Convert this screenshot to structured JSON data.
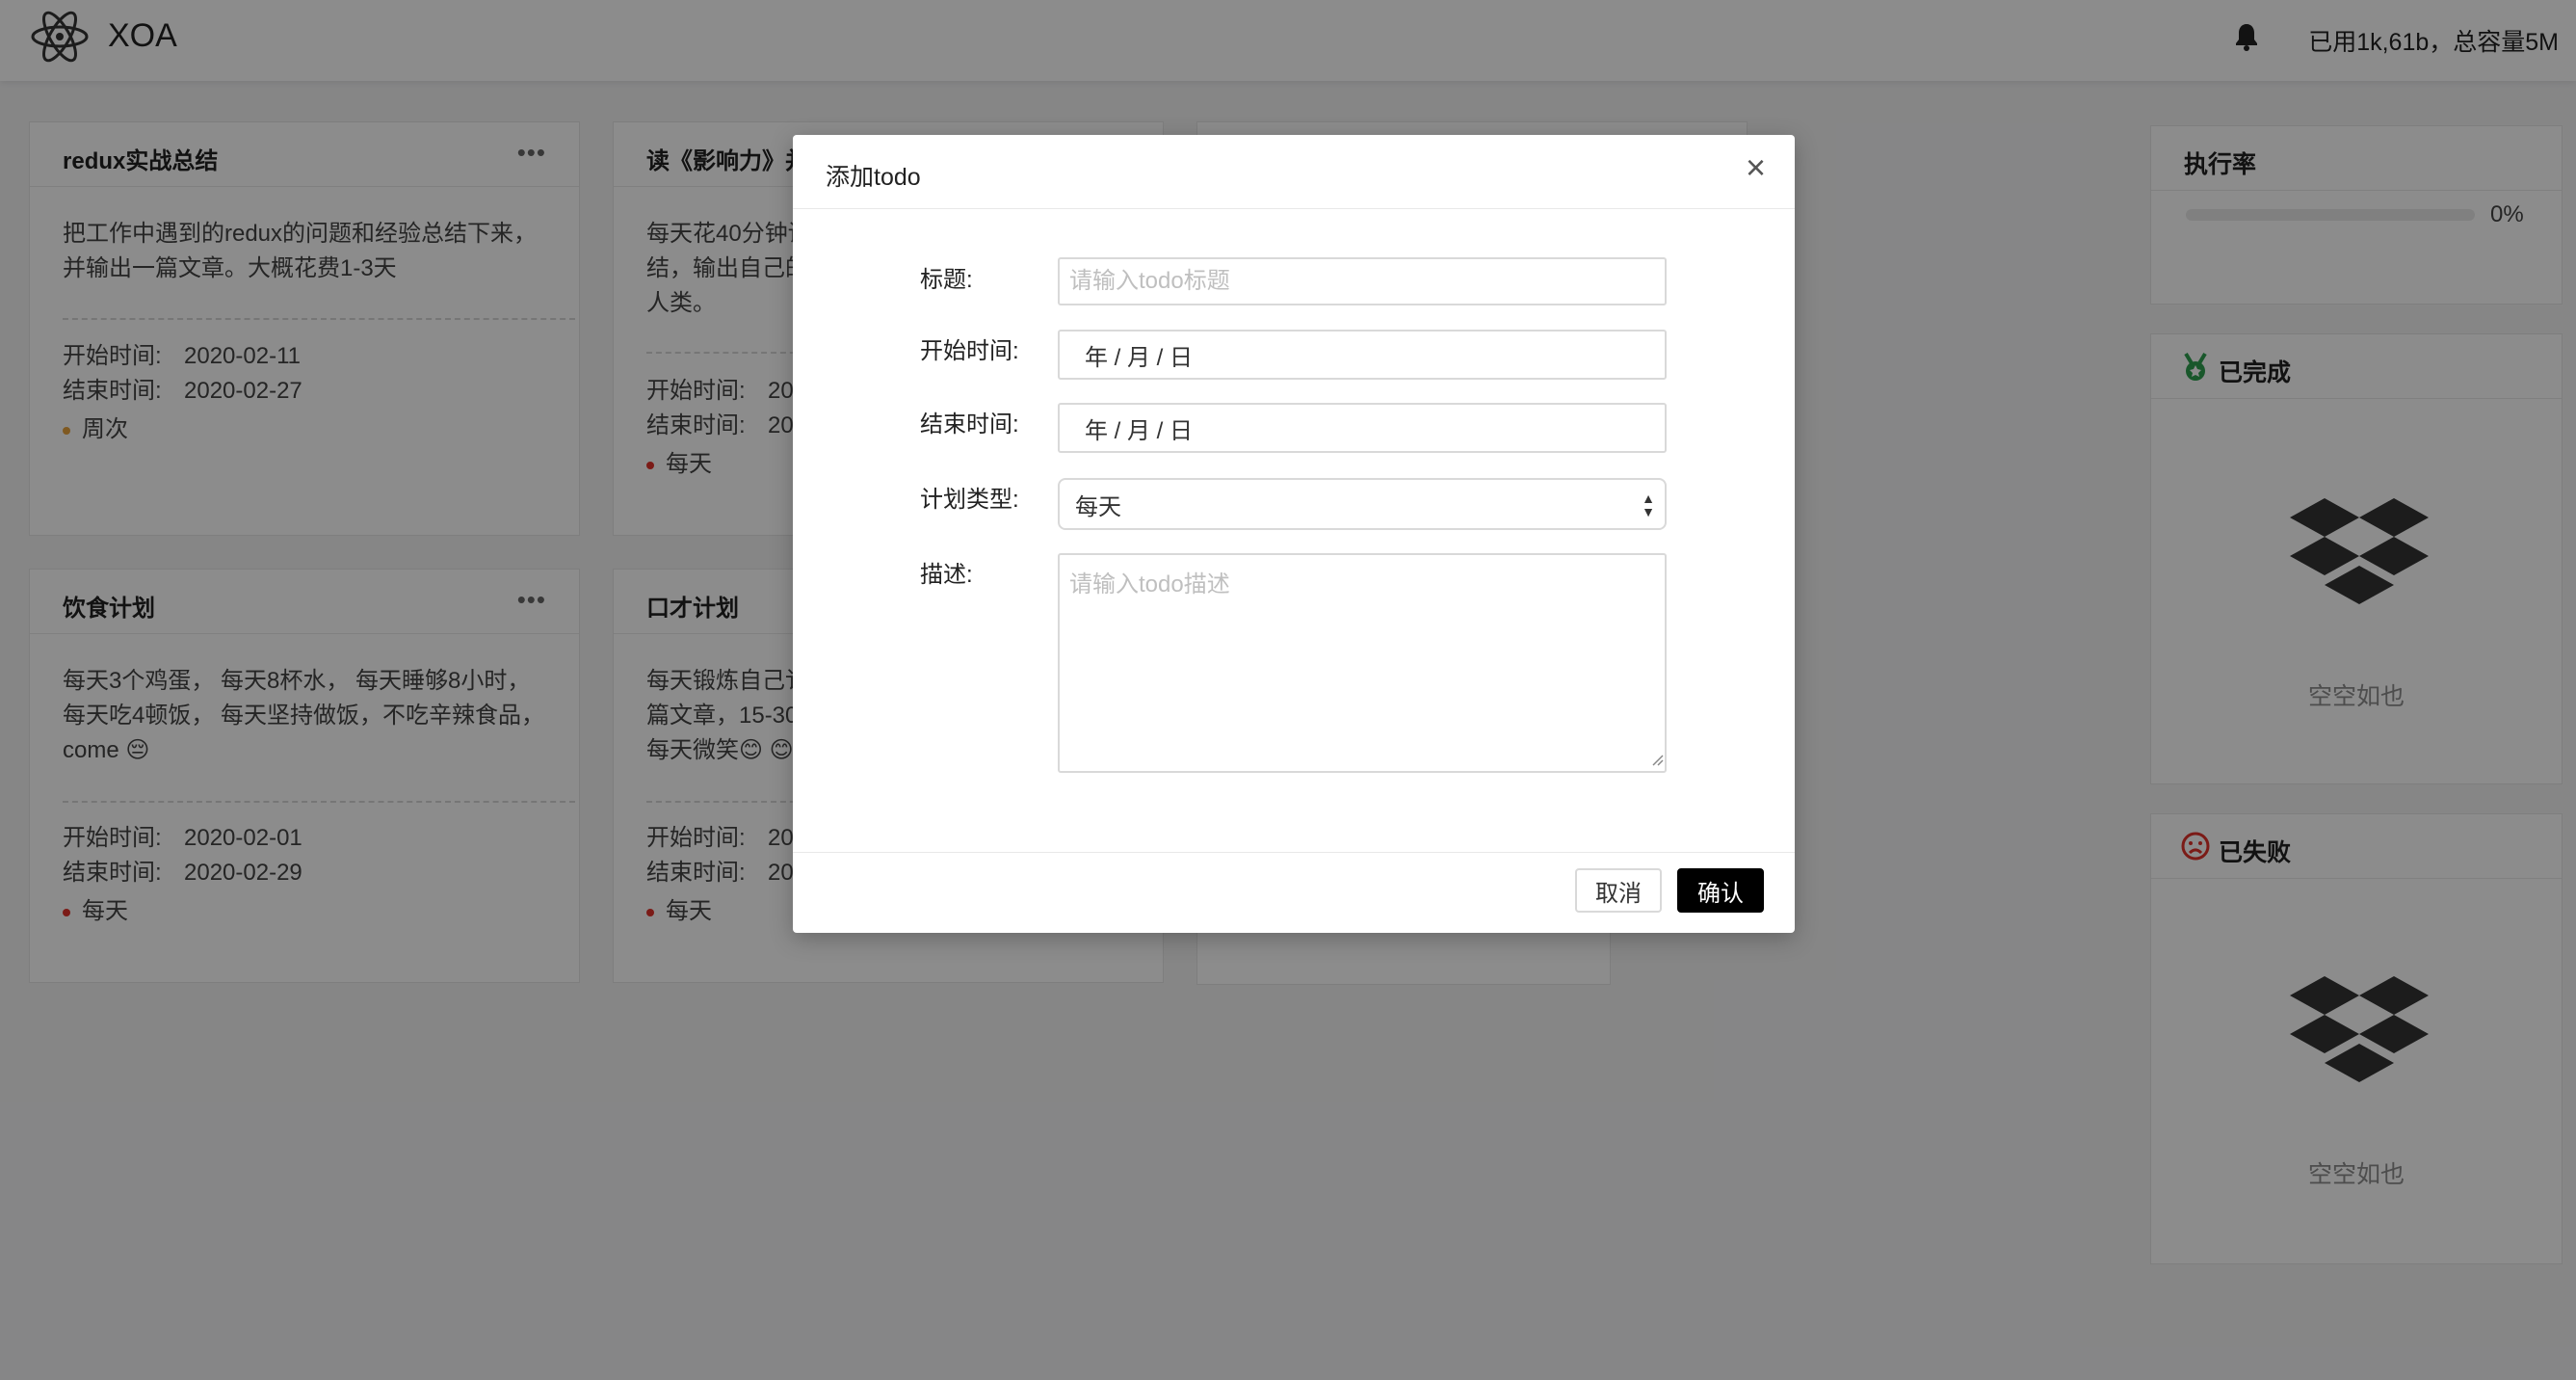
{
  "app": {
    "title": "XOA",
    "usage": "已用1k,61b，总容量5M"
  },
  "cards": [
    {
      "title": "redux实战总结",
      "desc_lines": [
        "把工作中遇到的redux的问题和经验总结下来，",
        "并输出一篇文章。大概花费1-3天"
      ],
      "start_label": "开始时间:",
      "start": "2020-02-11",
      "end_label": "结束时间:",
      "end": "2020-02-27",
      "type": "周次",
      "type_color": "#e8a23c"
    },
    {
      "title": "读《影响力》并",
      "desc_lines": [
        "每天花40分钟读",
        "结，输出自己的",
        "人类。"
      ],
      "start_label": "开始时间:",
      "start": "20",
      "end_label": "结束时间:",
      "end": "20",
      "type": "每天",
      "type_color": "#e0322a"
    },
    {
      "title": "饮食计划",
      "desc_lines": [
        "每天3个鸡蛋， 每天8杯水， 每天睡够8小时，",
        "每天吃4顿饭， 每天坚持做饭，不吃辛辣食品，",
        "come 😔"
      ],
      "start_label": "开始时间:",
      "start": "2020-02-01",
      "end_label": "结束时间:",
      "end": "2020-02-29",
      "type": "每天",
      "type_color": "#e0322a"
    },
    {
      "title": "口才计划",
      "desc_lines": [
        "每天锻炼自己讠",
        "篇文章，15-30",
        "每天微笑😊 😊"
      ],
      "start_label": "开始时间:",
      "start": "20",
      "end_label": "结束时间:",
      "end": "20",
      "type": "每天",
      "type_color": "#e0322a"
    }
  ],
  "sidebar": {
    "rate": {
      "title": "执行率",
      "percent": "0%",
      "value": 0
    },
    "done": {
      "title": "已完成",
      "empty": "空空如也"
    },
    "failed": {
      "title": "已失败",
      "empty": "空空如也"
    }
  },
  "modal": {
    "title": "添加todo",
    "close": "×",
    "title_label": "标题:",
    "title_placeholder": "请输入todo标题",
    "start_label": "开始时间:",
    "end_label": "结束时间:",
    "date_text": "年  / 月 / 日",
    "type_label": "计划类型:",
    "type_value": "每天",
    "desc_label": "描述:",
    "desc_placeholder": "请输入todo描述",
    "cancel": "取消",
    "ok": "确认"
  },
  "colors": {
    "accent": "#000000",
    "done_icon": "#2e9e4f",
    "failed_icon": "#e0322a"
  },
  "icons": {
    "logo": "atom-logo-icon",
    "bell": "bell-icon",
    "done": "medal-icon",
    "failed": "sad-face-icon",
    "empty": "dropbox-icon"
  }
}
